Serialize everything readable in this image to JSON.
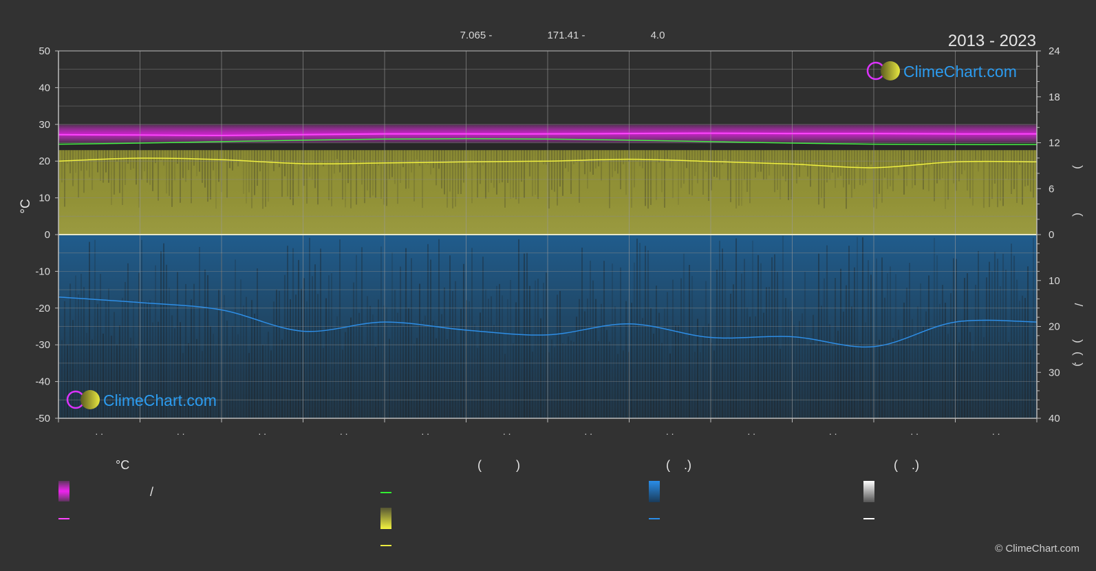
{
  "header": {
    "coords": [
      "7.065 -",
      "171.41 -",
      "4.0"
    ],
    "year_range": "2013 - 2023"
  },
  "logo": {
    "text": "ClimeChart.com"
  },
  "copyright": "© ClimeChart.com",
  "chart_data": {
    "type": "line",
    "title": "2013 - 2023",
    "ylabel_left": "°C",
    "ylim_left": [
      -50,
      50
    ],
    "yticks_left": [
      "50",
      "40",
      "30",
      "20",
      "10",
      "0",
      "-10",
      "-20",
      "-30",
      "-40",
      "-50"
    ],
    "ylim_right_top": [
      0,
      24
    ],
    "yticks_right_top": [
      "24",
      "18",
      "12",
      "6",
      "0"
    ],
    "ylim_right_bottom": [
      0,
      40
    ],
    "yticks_right_bottom": [
      "10",
      "20",
      "30",
      "40"
    ],
    "x_months": 12,
    "xtick_labels": [
      ". .",
      ". .",
      ". .",
      ". .",
      ". .",
      ". .",
      ". .",
      ". .",
      ". .",
      ". .",
      ". .",
      ". ."
    ],
    "right_axis_glyphs": [
      ")",
      "(",
      ")",
      "/",
      ")",
      "(",
      "."
    ],
    "grid": true,
    "series": [
      {
        "key": "max_temp",
        "color": "#ff44ff",
        "values": [
          27.2,
          27.1,
          27.0,
          27.2,
          27.4,
          27.4,
          27.4,
          27.5,
          27.6,
          27.5,
          27.5,
          27.4,
          27.4
        ]
      },
      {
        "key": "sea_temp",
        "color": "#44ee44",
        "values": [
          24.6,
          24.9,
          25.3,
          25.7,
          26.0,
          26.1,
          26.0,
          25.7,
          25.3,
          24.9,
          24.6,
          24.5,
          24.5
        ]
      },
      {
        "key": "daylight",
        "color": "#f0f040",
        "values": [
          20.0,
          20.8,
          20.4,
          19.3,
          19.5,
          19.8,
          20.0,
          20.5,
          19.9,
          19.2,
          18.2,
          19.8,
          19.8
        ]
      },
      {
        "key": "precipitation",
        "color": "#2e8ee6",
        "values": [
          -17.0,
          -18.5,
          -20.5,
          -26.3,
          -23.8,
          -26.0,
          -27.3,
          -24.3,
          -28.0,
          -27.8,
          -30.5,
          -23.8,
          -23.8
        ]
      }
    ]
  },
  "legend": {
    "col1_head": "°C",
    "col1_slash": "/",
    "col2_head": "(          )",
    "col3_head": "(    .)",
    "col4_head": "(    .)"
  },
  "colors": {
    "background": "#323232",
    "grid": "#777777",
    "magenta": "#ff33ff",
    "green": "#33ee33",
    "yellow": "#eaea40",
    "blue": "#2a8de8",
    "white": "#ffffff"
  }
}
